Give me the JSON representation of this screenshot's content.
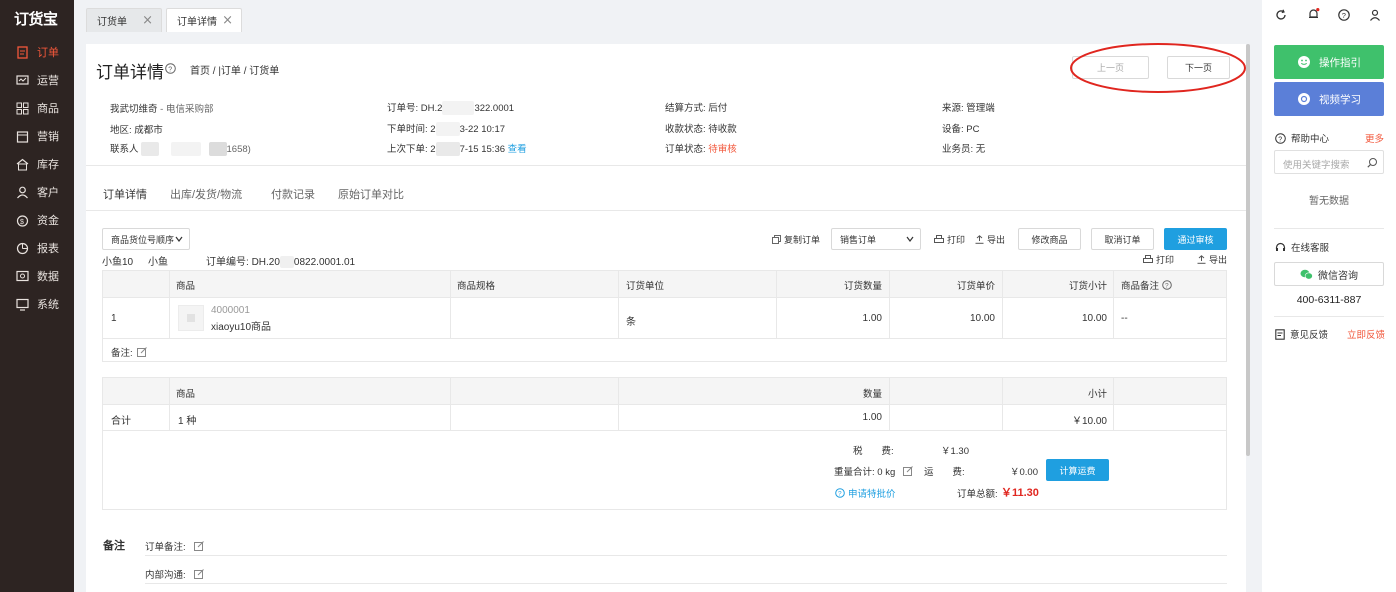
{
  "app": {
    "logo": "订货宝"
  },
  "sidebar": {
    "items": [
      {
        "label": "订单",
        "icon": "order-icon",
        "active": true
      },
      {
        "label": "运营",
        "icon": "operation-icon",
        "active": false
      },
      {
        "label": "商品",
        "icon": "goods-icon",
        "active": false
      },
      {
        "label": "营销",
        "icon": "marketing-icon",
        "active": false
      },
      {
        "label": "库存",
        "icon": "inventory-icon",
        "active": false
      },
      {
        "label": "客户",
        "icon": "customer-icon",
        "active": false
      },
      {
        "label": "资金",
        "icon": "funds-icon",
        "active": false
      },
      {
        "label": "报表",
        "icon": "report-icon",
        "active": false
      },
      {
        "label": "数据",
        "icon": "data-icon",
        "active": false
      },
      {
        "label": "系统",
        "icon": "system-icon",
        "active": false
      }
    ]
  },
  "tabs": [
    {
      "label": "订货单"
    },
    {
      "label": "订单详情"
    }
  ],
  "header": {
    "title": "订单详情",
    "breadcrumb": "首页 / |订单 / 订货单",
    "prev_label": "上一页",
    "next_label": "下一页"
  },
  "info": {
    "customer": "我武切维奇",
    "dept": "- 电信采购部",
    "region_key": "地区:",
    "region_val": "成都市",
    "contact_key": "联系人",
    "contact_tail": "1658)",
    "order_no_key": "订单号:",
    "order_no_a": "DH.2",
    "order_no_b": "322.0001",
    "order_time_key": "下单时间:",
    "order_time_a": "2",
    "order_time_b": "3-22 10:17",
    "last_order_key": "上次下单:",
    "last_order_a": "2",
    "last_order_b": "7-15 15:36",
    "view_link": "查看",
    "settle_key": "结算方式:",
    "settle_val": "后付",
    "pay_key": "收款状态:",
    "pay_val": "待收款",
    "status_key": "订单状态:",
    "status_val": "待审核",
    "source_key": "来源:",
    "source_val": "管理端",
    "device_key": "设备:",
    "device_val": "PC",
    "sales_key": "业务员:",
    "sales_val": "无"
  },
  "page_tabs": [
    "订单详情",
    "出库/发货/物流",
    "付款记录",
    "原始订单对比"
  ],
  "toolbar": {
    "sort_select": "商品货位号顺序",
    "copy": "复制订单",
    "order_type": "销售订单",
    "print": "打印",
    "export": "导出",
    "modify": "修改商品",
    "cancel": "取消订单",
    "approve": "通过审核"
  },
  "sub": {
    "store1": "小鱼10",
    "store2": "小鱼",
    "order_no_label": "订单编号:",
    "order_no_a": "DH.20",
    "order_no_b": "0822.0001.01",
    "print": "打印",
    "export": "导出"
  },
  "table": {
    "headers": [
      "商品",
      "商品规格",
      "订货单位",
      "订货数量",
      "订货单价",
      "订货小计",
      "商品备注"
    ],
    "rows": [
      {
        "idx": "1",
        "code": "4000001",
        "name": "xiaoyu10商品",
        "spec": "",
        "unit": "条",
        "qty": "1.00",
        "price": "10.00",
        "subtotal": "10.00",
        "remark": "--"
      }
    ],
    "remark_label": "备注:"
  },
  "summary": {
    "headers": [
      "商品",
      "数量",
      "小计"
    ],
    "total_label": "合计",
    "kinds": "1 种",
    "qty": "1.00",
    "subtotal": "￥10.00"
  },
  "fees": {
    "tax_label": "税　　费:",
    "tax_val": "￥1.30",
    "weight_label": "重量合计: 0 kg",
    "freight_label": "运　　费:",
    "freight_val": "￥0.00",
    "calc_btn": "计算运费",
    "special": "申请特批价",
    "total_label": "订单总额:",
    "total_val": "￥11.30"
  },
  "notes": {
    "title": "备注",
    "order_note": "订单备注:",
    "internal_note": "内部沟通:"
  },
  "right": {
    "guide": "操作指引",
    "video": "视频学习",
    "help": "帮助中心",
    "more": "更多",
    "search_placeholder": "使用关键字搜索",
    "no_data": "暂无数据",
    "service": "在线客服",
    "wechat": "微信咨询",
    "phone": "400-6311-887",
    "feedback": "意见反馈",
    "feedback_link": "立即反馈"
  },
  "colors": {
    "sidebar_bg": "#2d2422",
    "accent": "#f2573b",
    "primary": "#1f9fe0",
    "green": "#3fc16c",
    "blue": "#5b7fd8",
    "red": "#e0261f"
  }
}
